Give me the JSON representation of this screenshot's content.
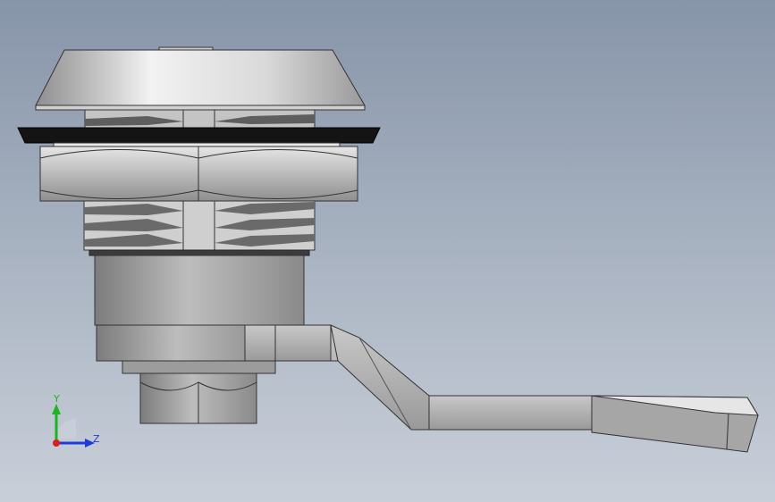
{
  "viewport": {
    "background_top": "#8795a9",
    "background_bottom": "#c9cfd9"
  },
  "model": {
    "parts": [
      "cap",
      "gasket",
      "hex-nut",
      "threaded-body",
      "cylinder-housing",
      "sleeve",
      "lock-nut",
      "cam-lever"
    ],
    "colors": {
      "metal_light": "#d8d8d8",
      "metal_mid": "#a9a9a9",
      "metal_dark": "#5a5a5a",
      "gasket": "#141414"
    }
  },
  "triad": {
    "y_label": "Y",
    "z_label": "Z",
    "icon": "coordinate-triad-icon",
    "colors": {
      "y": "#1fb31f",
      "z": "#1f3bd6",
      "x": "#d61f1f"
    }
  }
}
